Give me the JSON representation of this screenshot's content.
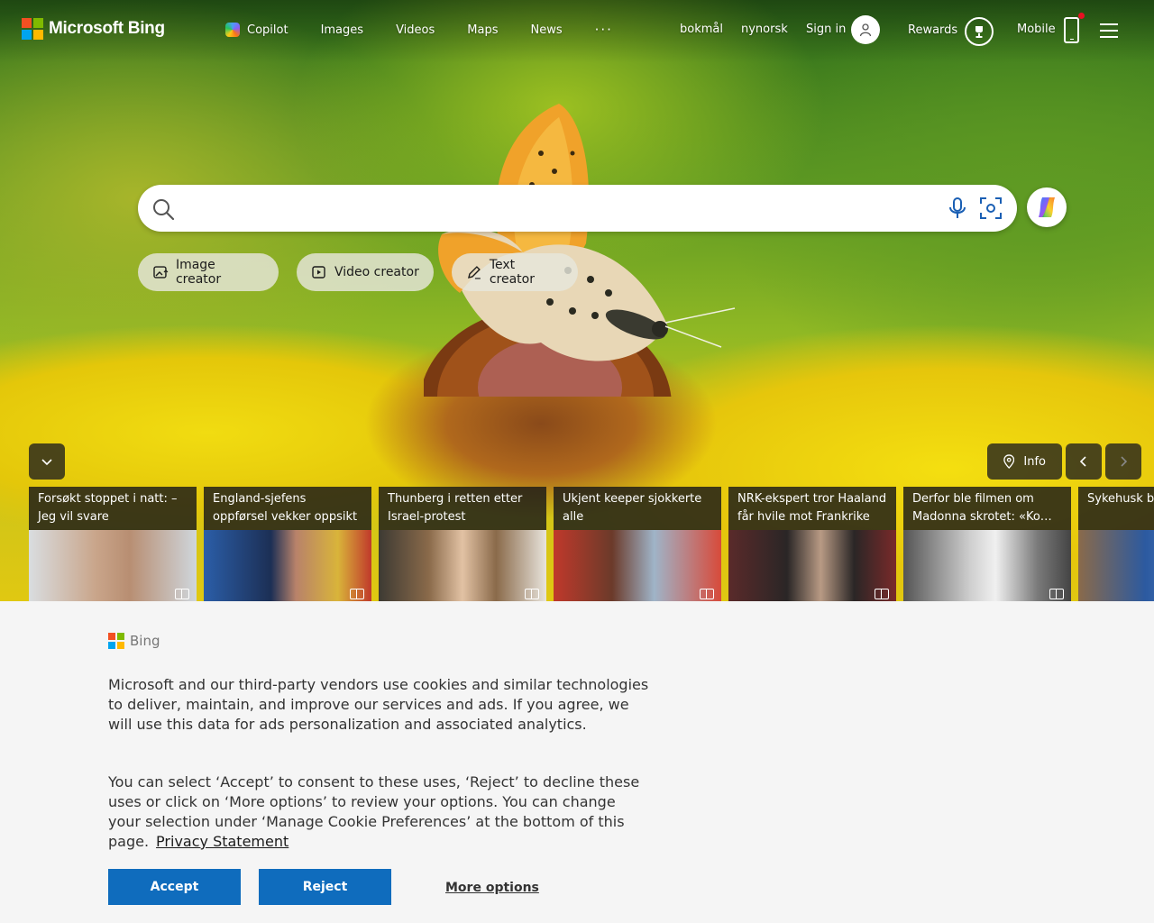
{
  "header": {
    "logo_text": "Microsoft Bing",
    "nav": {
      "copilot": "Copilot",
      "images": "Images",
      "videos": "Videos",
      "maps": "Maps",
      "news": "News",
      "more": "···"
    },
    "lang_bokmal": "bokmål",
    "lang_nynorsk": "nynorsk",
    "sign_in": "Sign in",
    "rewards": "Rewards",
    "mobile": "Mobile"
  },
  "search": {
    "placeholder": "",
    "value": ""
  },
  "creators": {
    "image": "Image creator",
    "video": "Video creator",
    "text": "Text creator"
  },
  "carousel": {
    "info": "Info"
  },
  "news_cards": [
    {
      "title": "Forsøkt stoppet i natt: – Jeg vil svare"
    },
    {
      "title": "England-sjefens oppførsel vekker oppsikt"
    },
    {
      "title": "Thunberg i retten etter Israel-protest"
    },
    {
      "title": "Ukjent keeper sjokkerte alle"
    },
    {
      "title": "NRK-ekspert tror Haaland får hvile mot Frankrike"
    },
    {
      "title": "Derfor ble filmen om Madonna skrotet: «Ko…"
    },
    {
      "title": "Sykehusk barn livet"
    }
  ],
  "cookie": {
    "logo_text": "Bing",
    "paragraph1": "Microsoft and our third-party vendors use cookies and similar technologies to deliver, maintain, and improve our services and ads. If you agree, we will use this data for ads personalization and associated analytics.",
    "paragraph2": "You can select ‘Accept’ to consent to these uses, ‘Reject’ to decline these uses or click on ‘More options’ to review your options. You can change your selection under ‘Manage Cookie Preferences’ at the bottom of this page.",
    "privacy_link": "Privacy Statement",
    "accept": "Accept",
    "reject": "Reject",
    "more_options": "More options"
  },
  "colors": {
    "ms_red": "#f25022",
    "ms_green": "#7fba00",
    "ms_blue": "#00a4ef",
    "ms_yellow": "#ffb900",
    "button_blue": "#0f6cbd"
  }
}
